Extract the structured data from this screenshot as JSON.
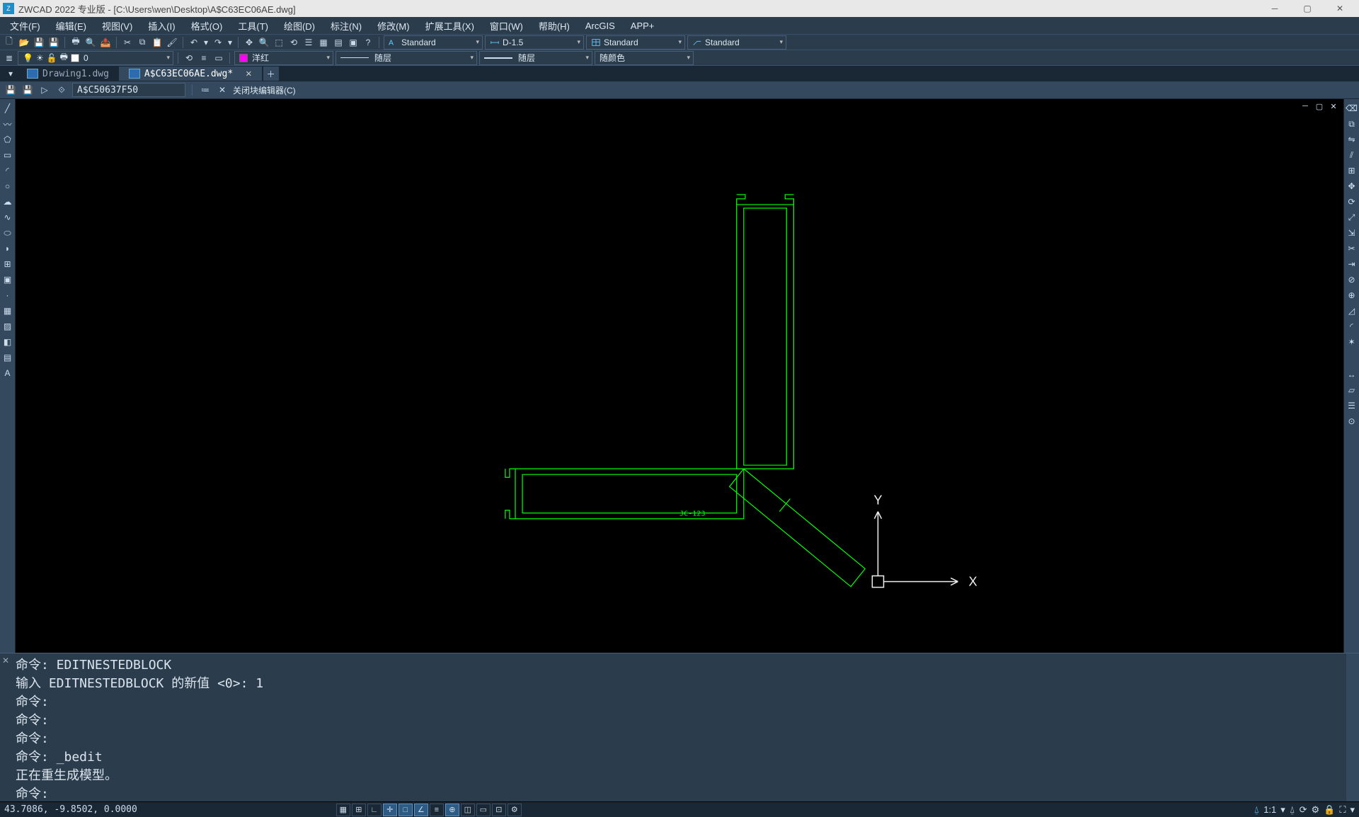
{
  "title": "ZWCAD 2022 专业版 - [C:\\Users\\wen\\Desktop\\A$C63EC06AE.dwg]",
  "menus": [
    "文件(F)",
    "编辑(E)",
    "视图(V)",
    "插入(I)",
    "格式(O)",
    "工具(T)",
    "绘图(D)",
    "标注(N)",
    "修改(M)",
    "扩展工具(X)",
    "窗口(W)",
    "帮助(H)",
    "ArcGIS",
    "APP+"
  ],
  "style_dd1": "Standard",
  "style_dd2": "D-1.5",
  "style_dd3": "Standard",
  "style_dd4": "Standard",
  "layer_val": "0",
  "color_name": "洋红",
  "color_hex": "#ff00ff",
  "linetype": "随层",
  "lineweight": "随层",
  "plotstyle": "随颜色",
  "tabs": {
    "inactive": "Drawing1.dwg",
    "active": "A$C63EC06AE.dwg*"
  },
  "block": {
    "name": "A$C50637F50",
    "close_label": "关闭块编辑器(C)"
  },
  "axis_x": "X",
  "axis_y": "Y",
  "drawing_label": "JC-123",
  "cmd_lines": [
    "命令: EDITNESTEDBLOCK",
    "输入 EDITNESTEDBLOCK 的新值 <0>: 1",
    "命令:",
    "命令:",
    "命令:",
    "命令: _bedit",
    "正在重生成模型。",
    "命令: "
  ],
  "status": {
    "coords": "43.7086, -9.8502, 0.0000",
    "scale": "1:1"
  }
}
